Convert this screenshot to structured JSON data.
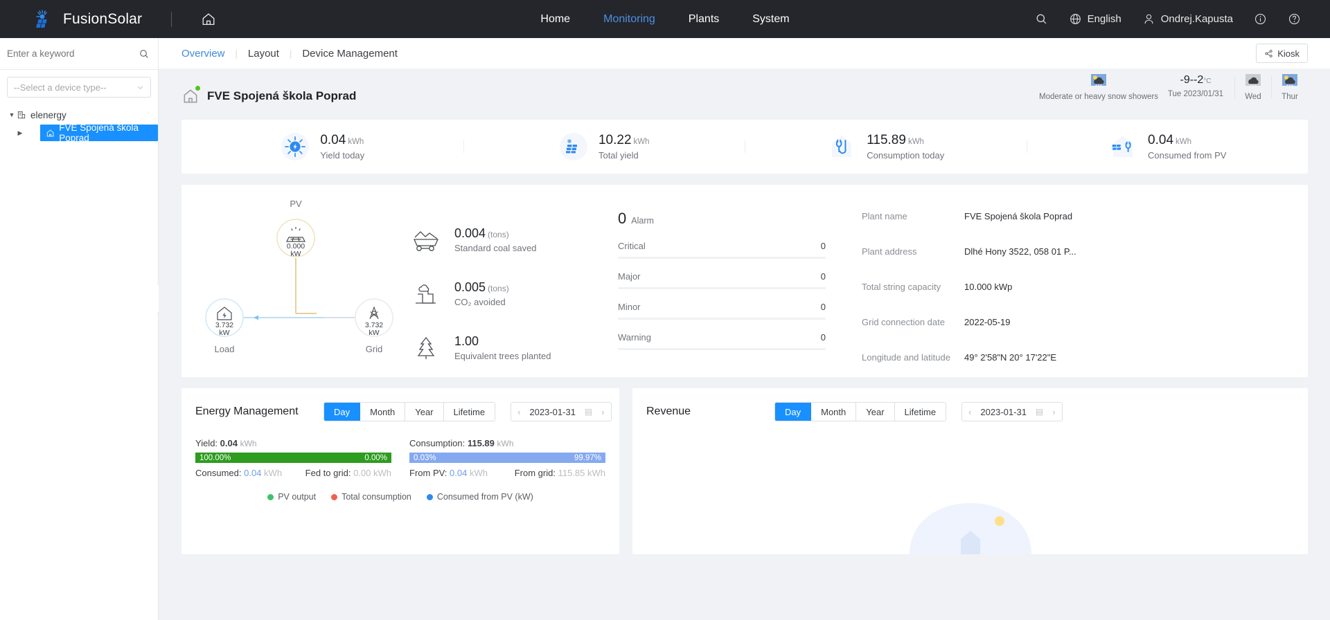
{
  "header": {
    "brand": "FusionSolar",
    "home_icon": "home-icon",
    "search_icon": "search-icon",
    "nav": [
      {
        "label": "Home",
        "active": false
      },
      {
        "label": "Monitoring",
        "active": true
      },
      {
        "label": "Plants",
        "active": false
      },
      {
        "label": "System",
        "active": false
      }
    ],
    "language": "English",
    "user": "Ondrej.Kapusta",
    "info_icon": "info-icon",
    "help_icon": "help-icon"
  },
  "sidebar": {
    "search_placeholder": "Enter a keyword",
    "device_type_select": "--Select a device type--",
    "tree": {
      "root_label": "elenergy",
      "child_label": "FVE Spojená škola Poprad"
    }
  },
  "tabs": {
    "items": [
      {
        "label": "Overview",
        "active": true
      },
      {
        "label": "Layout",
        "active": false
      },
      {
        "label": "Device Management",
        "active": false
      }
    ],
    "kiosk_label": "Kiosk"
  },
  "plant": {
    "title": "FVE Spojená škola Poprad"
  },
  "weather": {
    "condition": "Moderate or heavy snow showers",
    "temperature": "-9--2",
    "temp_unit": "°C",
    "date": "Tue  2023/01/31",
    "day2": "Wed",
    "day3": "Thur"
  },
  "kpis": [
    {
      "value": "0.04",
      "unit": "kWh",
      "label": "Yield today",
      "icon": "sun-yield-icon"
    },
    {
      "value": "10.22",
      "unit": "kWh",
      "label": "Total yield",
      "icon": "solar-panel-icon"
    },
    {
      "value": "115.89",
      "unit": "kWh",
      "label": "Consumption today",
      "icon": "plug-house-icon"
    },
    {
      "value": "0.04",
      "unit": "kWh",
      "label": "Consumed from PV",
      "icon": "pv-consumption-icon"
    }
  ],
  "flow": {
    "pv_label": "PV",
    "pv_value": "0.000",
    "pv_unit": "kW",
    "load_label": "Load",
    "load_value": "3.732",
    "load_unit": "kW",
    "grid_label": "Grid",
    "grid_value": "3.732",
    "grid_unit": "kW"
  },
  "environment": [
    {
      "value": "0.004",
      "unit": "(tons)",
      "label": "Standard coal saved",
      "icon": "coal-cart-icon"
    },
    {
      "value": "0.005",
      "unit": "(tons)",
      "label": "CO₂ avoided",
      "icon": "factory-icon"
    },
    {
      "value": "1.00",
      "unit": "",
      "label": "Equivalent trees planted",
      "icon": "tree-icon"
    }
  ],
  "alarms": {
    "total": "0",
    "total_label": "Alarm",
    "levels": [
      {
        "label": "Critical",
        "count": "0"
      },
      {
        "label": "Major",
        "count": "0"
      },
      {
        "label": "Minor",
        "count": "0"
      },
      {
        "label": "Warning",
        "count": "0"
      }
    ]
  },
  "plant_info": [
    {
      "key": "Plant name",
      "value": "FVE Spojená škola Poprad"
    },
    {
      "key": "Plant address",
      "value": "Dlhé Hony 3522, 058 01 P..."
    },
    {
      "key": "Total string capacity",
      "value": "10.000 kWp"
    },
    {
      "key": "Grid connection date",
      "value": "2022-05-19"
    },
    {
      "key": "Longitude and latitude",
      "value": "49° 2'58\"N   20° 17'22\"E"
    }
  ],
  "energy_panel": {
    "title": "Energy Management",
    "ranges": [
      {
        "label": "Day",
        "active": true
      },
      {
        "label": "Month",
        "active": false
      },
      {
        "label": "Year",
        "active": false
      },
      {
        "label": "Lifetime",
        "active": false
      }
    ],
    "date": "2023-01-31",
    "yield": {
      "title_key": "Yield:",
      "title_value": "0.04",
      "title_unit": "kWh",
      "left_pct": "100.00%",
      "right_pct": "0.00%",
      "left_key": "Consumed:",
      "left_value": "0.04",
      "left_unit": "kWh",
      "right_key": "Fed to grid:",
      "right_value": "0.00",
      "right_unit": "kWh"
    },
    "consumption": {
      "title_key": "Consumption:",
      "title_value": "115.89",
      "title_unit": "kWh",
      "left_pct": "0.03%",
      "right_pct": "99.97%",
      "left_key": "From PV:",
      "left_value": "0.04",
      "left_unit": "kWh",
      "right_key": "From grid:",
      "right_value": "115.85",
      "right_unit": "kWh"
    },
    "legend": [
      {
        "label": "PV output",
        "color": "#3fc26a"
      },
      {
        "label": "Total consumption",
        "color": "#f0604d"
      },
      {
        "label": "Consumed from PV (kW)",
        "color": "#2f8aef"
      }
    ]
  },
  "revenue_panel": {
    "title": "Revenue",
    "ranges": [
      {
        "label": "Day",
        "active": true
      },
      {
        "label": "Month",
        "active": false
      },
      {
        "label": "Year",
        "active": false
      },
      {
        "label": "Lifetime",
        "active": false
      }
    ],
    "date": "2023-01-31"
  },
  "colors": {
    "accent": "#1890ff",
    "nav_active": "#4f8fe0",
    "topbar_bg": "#24262b",
    "yield_bar": "#2d9c1f",
    "consumption_bar": "#85a9f0",
    "status_dot": "#52c41a"
  }
}
